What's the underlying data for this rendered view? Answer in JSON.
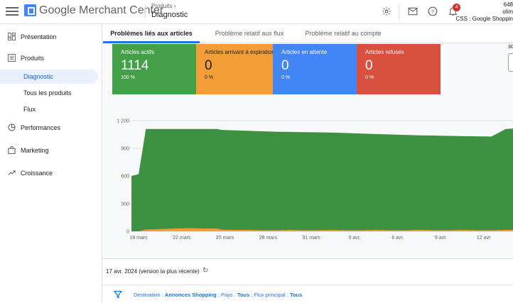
{
  "header": {
    "product_name": "Google Merchant Center",
    "breadcrumb_parent": "Produits",
    "breadcrumb_current": "Diagnostic",
    "notifications_count": "4",
    "account_id": "648",
    "account_name": "olim",
    "css_label": "CSS : Google Shoppin"
  },
  "sidebar": {
    "items": [
      {
        "label": "Présentation",
        "icon": "dashboard-icon"
      },
      {
        "label": "Produits",
        "icon": "list-icon"
      },
      {
        "label": "Diagnostic"
      },
      {
        "label": "Tous les produits"
      },
      {
        "label": "Flux"
      },
      {
        "label": "Performances",
        "icon": "pie-icon"
      },
      {
        "label": "Marketing",
        "icon": "bag-icon"
      },
      {
        "label": "Croissance",
        "icon": "trend-icon"
      }
    ]
  },
  "tabs": [
    {
      "label": "Problèmes liés aux articles",
      "active": true
    },
    {
      "label": "Problème relatif aux flux"
    },
    {
      "label": "Problème relatif au compte"
    }
  ],
  "cards": [
    {
      "title": "Articles actifs",
      "value": "1114",
      "percent": "100 %",
      "color": "#43a047"
    },
    {
      "title": "Articles arrivant à expiration",
      "value": "0",
      "percent": "0 %",
      "color": "#f29d38"
    },
    {
      "title": "Articles en attente",
      "value": "0",
      "percent": "0 %",
      "color": "#4285f4"
    },
    {
      "title": "Articles refusés",
      "value": "0",
      "percent": "0 %",
      "color": "#d9503f"
    }
  ],
  "edge_label": "30",
  "chart_data": {
    "type": "area",
    "y_ticks": [
      "0",
      "300",
      "600",
      "900",
      "1 200"
    ],
    "ylim": [
      0,
      1200
    ],
    "x_ticks": [
      "19 mars",
      "22 mars",
      "25 mars",
      "28 mars",
      "31 mars",
      "3 avr.",
      "6 avr.",
      "9 avr.",
      "12 avr."
    ],
    "x": [
      0,
      0.5,
      1,
      2,
      3,
      4,
      5,
      6,
      6.2,
      7,
      8,
      9,
      10,
      11,
      12,
      13,
      14,
      15,
      16,
      17,
      18,
      19,
      20,
      21,
      22,
      23,
      24,
      25,
      26,
      26.5
    ],
    "series": [
      {
        "color": "#3f9142",
        "values": [
          600,
          620,
          1110,
          1110,
          1110,
          1110,
          1110,
          1110,
          1100,
          1095,
          1090,
          1085,
          1080,
          1078,
          1075,
          1073,
          1070,
          1065,
          1060,
          1055,
          1050,
          1045,
          1040,
          1038,
          1035,
          1032,
          1030,
          1028,
          1110,
          1114
        ]
      },
      {
        "color": "#f29d38",
        "values": [
          0,
          0,
          20,
          25,
          30,
          35,
          30,
          30,
          20,
          15,
          15,
          12,
          12,
          15,
          12,
          12,
          15,
          12,
          12,
          15,
          12,
          12,
          15,
          12,
          12,
          15,
          12,
          12,
          15,
          15
        ]
      }
    ]
  },
  "footer": {
    "date": "17 avr. 2024 (version la plus récente)",
    "filter_destination_label": "Destination : ",
    "filter_destination_value": "Annonces Shopping",
    "filter_country_label": " ; Pays : ",
    "filter_country_value": "Tous",
    "filter_feed_label": " ; Flux principal : ",
    "filter_feed_value": "Tous"
  }
}
